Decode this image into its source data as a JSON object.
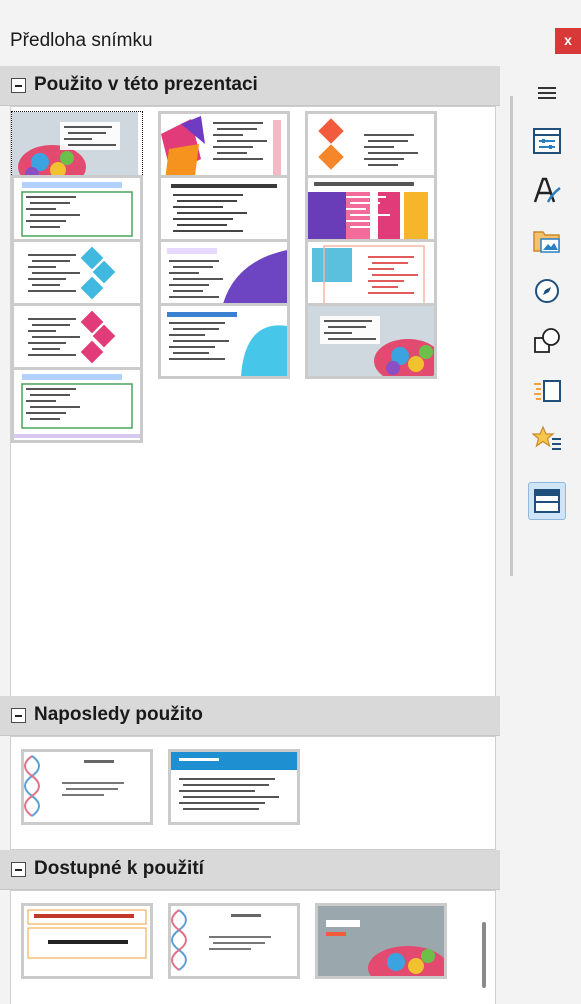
{
  "panel": {
    "title": "Předloha snímku",
    "close_label": "x"
  },
  "sections": {
    "used": {
      "label": "Použito v této prezentaci"
    },
    "recent": {
      "label": "Naposledy použito"
    },
    "available": {
      "label": "Dostupné k použití"
    }
  },
  "thumbnails": {
    "used": [
      {
        "theme": "candy",
        "title": "Klikněte pro úpravu formátu textu"
      },
      {
        "theme": "pink-orange",
        "title": "Klikněte pro úpravu formátu"
      },
      {
        "theme": "orange-diamond",
        "title": "Klikněte pro úpravu"
      },
      {
        "theme": "green-frame",
        "title": "Klikněte pro úpravu formátu"
      },
      {
        "theme": "plain",
        "title": "Klikněte pro úpravu formátu textu"
      },
      {
        "theme": "bars",
        "title": "Klikněte pro úpravu formátu"
      },
      {
        "theme": "blue-diamond",
        "title": "Klikněte pro úpravu"
      },
      {
        "theme": "purple-arc",
        "title": "Klikněte pro úpravu"
      },
      {
        "theme": "blue-square",
        "title": "Klikněte pro úpravu"
      },
      {
        "theme": "pink-diamond",
        "title": "Klikněte pro úpravu"
      },
      {
        "theme": "blue-arc",
        "title": "Klikněte pro úpravu formátu textu"
      },
      {
        "theme": "candy2",
        "title": "Klikněte pro úpravu formátu"
      },
      {
        "theme": "green-frame",
        "title": "Klikněte pro úpravu formátu textu"
      }
    ],
    "recent": [
      {
        "theme": "dna",
        "title": "Lorem Ipsum"
      },
      {
        "theme": "blue-header",
        "title": ""
      }
    ],
    "available": [
      {
        "theme": "red-title",
        "title": "Klikněte pro úpravu"
      },
      {
        "theme": "dna",
        "title": "Lorem Ipsum"
      },
      {
        "theme": "candy-lorem",
        "title": "Lorem"
      }
    ]
  },
  "sidebar": {
    "items": [
      {
        "icon": "menu-icon"
      },
      {
        "icon": "properties-icon"
      },
      {
        "icon": "styles-icon"
      },
      {
        "icon": "gallery-icon"
      },
      {
        "icon": "navigator-icon"
      },
      {
        "icon": "shapes-icon"
      },
      {
        "icon": "slide-transition-icon"
      },
      {
        "icon": "animation-icon"
      },
      {
        "icon": "master-slides-icon"
      }
    ]
  },
  "colors": {
    "accent": "#cfe4f7",
    "close": "#d83838",
    "header": "#d9d9d9"
  }
}
